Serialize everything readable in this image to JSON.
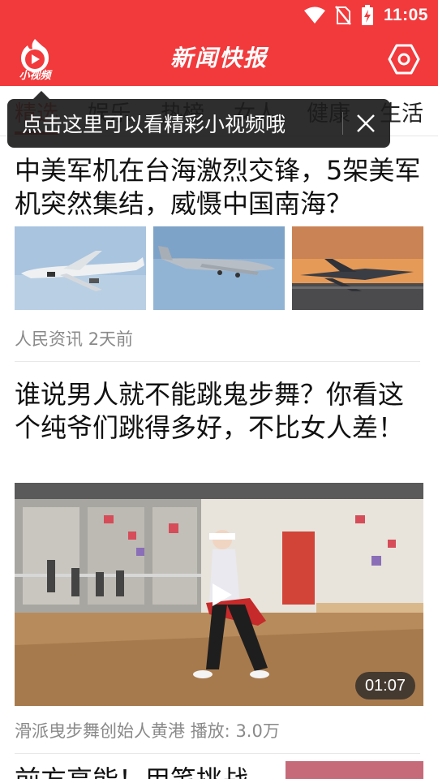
{
  "status_bar": {
    "time": "11:05",
    "icons": [
      "wifi-icon",
      "no-sim-icon",
      "battery-charging-icon"
    ]
  },
  "app_bar": {
    "logo_label": "小视频",
    "title": "新闻快报",
    "settings_icon": "hexagon-settings-icon"
  },
  "tabs": [
    {
      "label": "精选",
      "active": true
    },
    {
      "label": "娱乐",
      "active": false
    },
    {
      "label": "热榜",
      "active": false
    },
    {
      "label": "女人",
      "active": false
    },
    {
      "label": "健康",
      "active": false
    },
    {
      "label": "生活",
      "active": false
    }
  ],
  "tooltip": {
    "text": "点击这里可以看精彩小视频哦",
    "close_icon": "close-icon"
  },
  "articles": [
    {
      "title": "中美军机在台海激烈交锋，5架美军机突然集结，威慑中国南海？",
      "source": "人民资讯",
      "time": "2天前",
      "images": [
        "surveillance-plane-photo",
        "transport-plane-photo",
        "fighter-jet-sunset-photo"
      ]
    },
    {
      "title": "谁说男人就不能跳鬼步舞？你看这个纯爷们跳得多好，不比女人差！",
      "source": "滑派曳步舞创始人黄港",
      "plays": "播放: 3.0万",
      "duration": "01:07",
      "media": "dance-studio-video"
    },
    {
      "title": "前方高能！用笔挑战"
    }
  ],
  "colors": {
    "brand_red": "#f23a3c",
    "meta_gray": "#8a8a8a"
  }
}
